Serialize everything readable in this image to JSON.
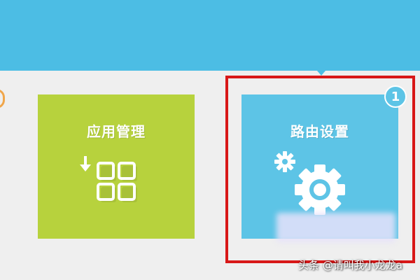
{
  "tiles": {
    "apps": {
      "title": "应用管理",
      "icon": "app-grid-download-icon",
      "color": "#b7d23d"
    },
    "router": {
      "title": "路由设置",
      "icon": "gear-icon",
      "color": "#5dc4e6"
    }
  },
  "annotation": {
    "step_number": "1",
    "highlight_color": "#d81818"
  },
  "watermark": "头条 @请叫我小龙龙a",
  "colors": {
    "banner": "#4cbde4",
    "background": "#efefef"
  }
}
